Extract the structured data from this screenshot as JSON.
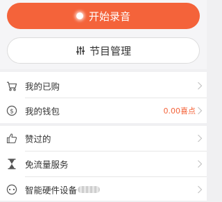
{
  "actions": {
    "record_label": "开始录音",
    "manage_label": "节目管理"
  },
  "menu_group_1": [
    {
      "label": "我的已购",
      "icon": "cart-icon"
    },
    {
      "label": "我的钱包",
      "icon": "wallet-coin-icon",
      "value": "0.00喜点"
    }
  ],
  "menu_group_2": [
    {
      "label": "赞过的",
      "icon": "thumbs-up-icon"
    },
    {
      "label": "免流量服务",
      "icon": "hourglass-icon"
    },
    {
      "label": "智能硬件设备",
      "icon": "device-icon"
    }
  ],
  "colors": {
    "accent": "#f4633a",
    "background": "#f0f0f2",
    "text": "#333333",
    "chevron": "#c4c4c4"
  }
}
